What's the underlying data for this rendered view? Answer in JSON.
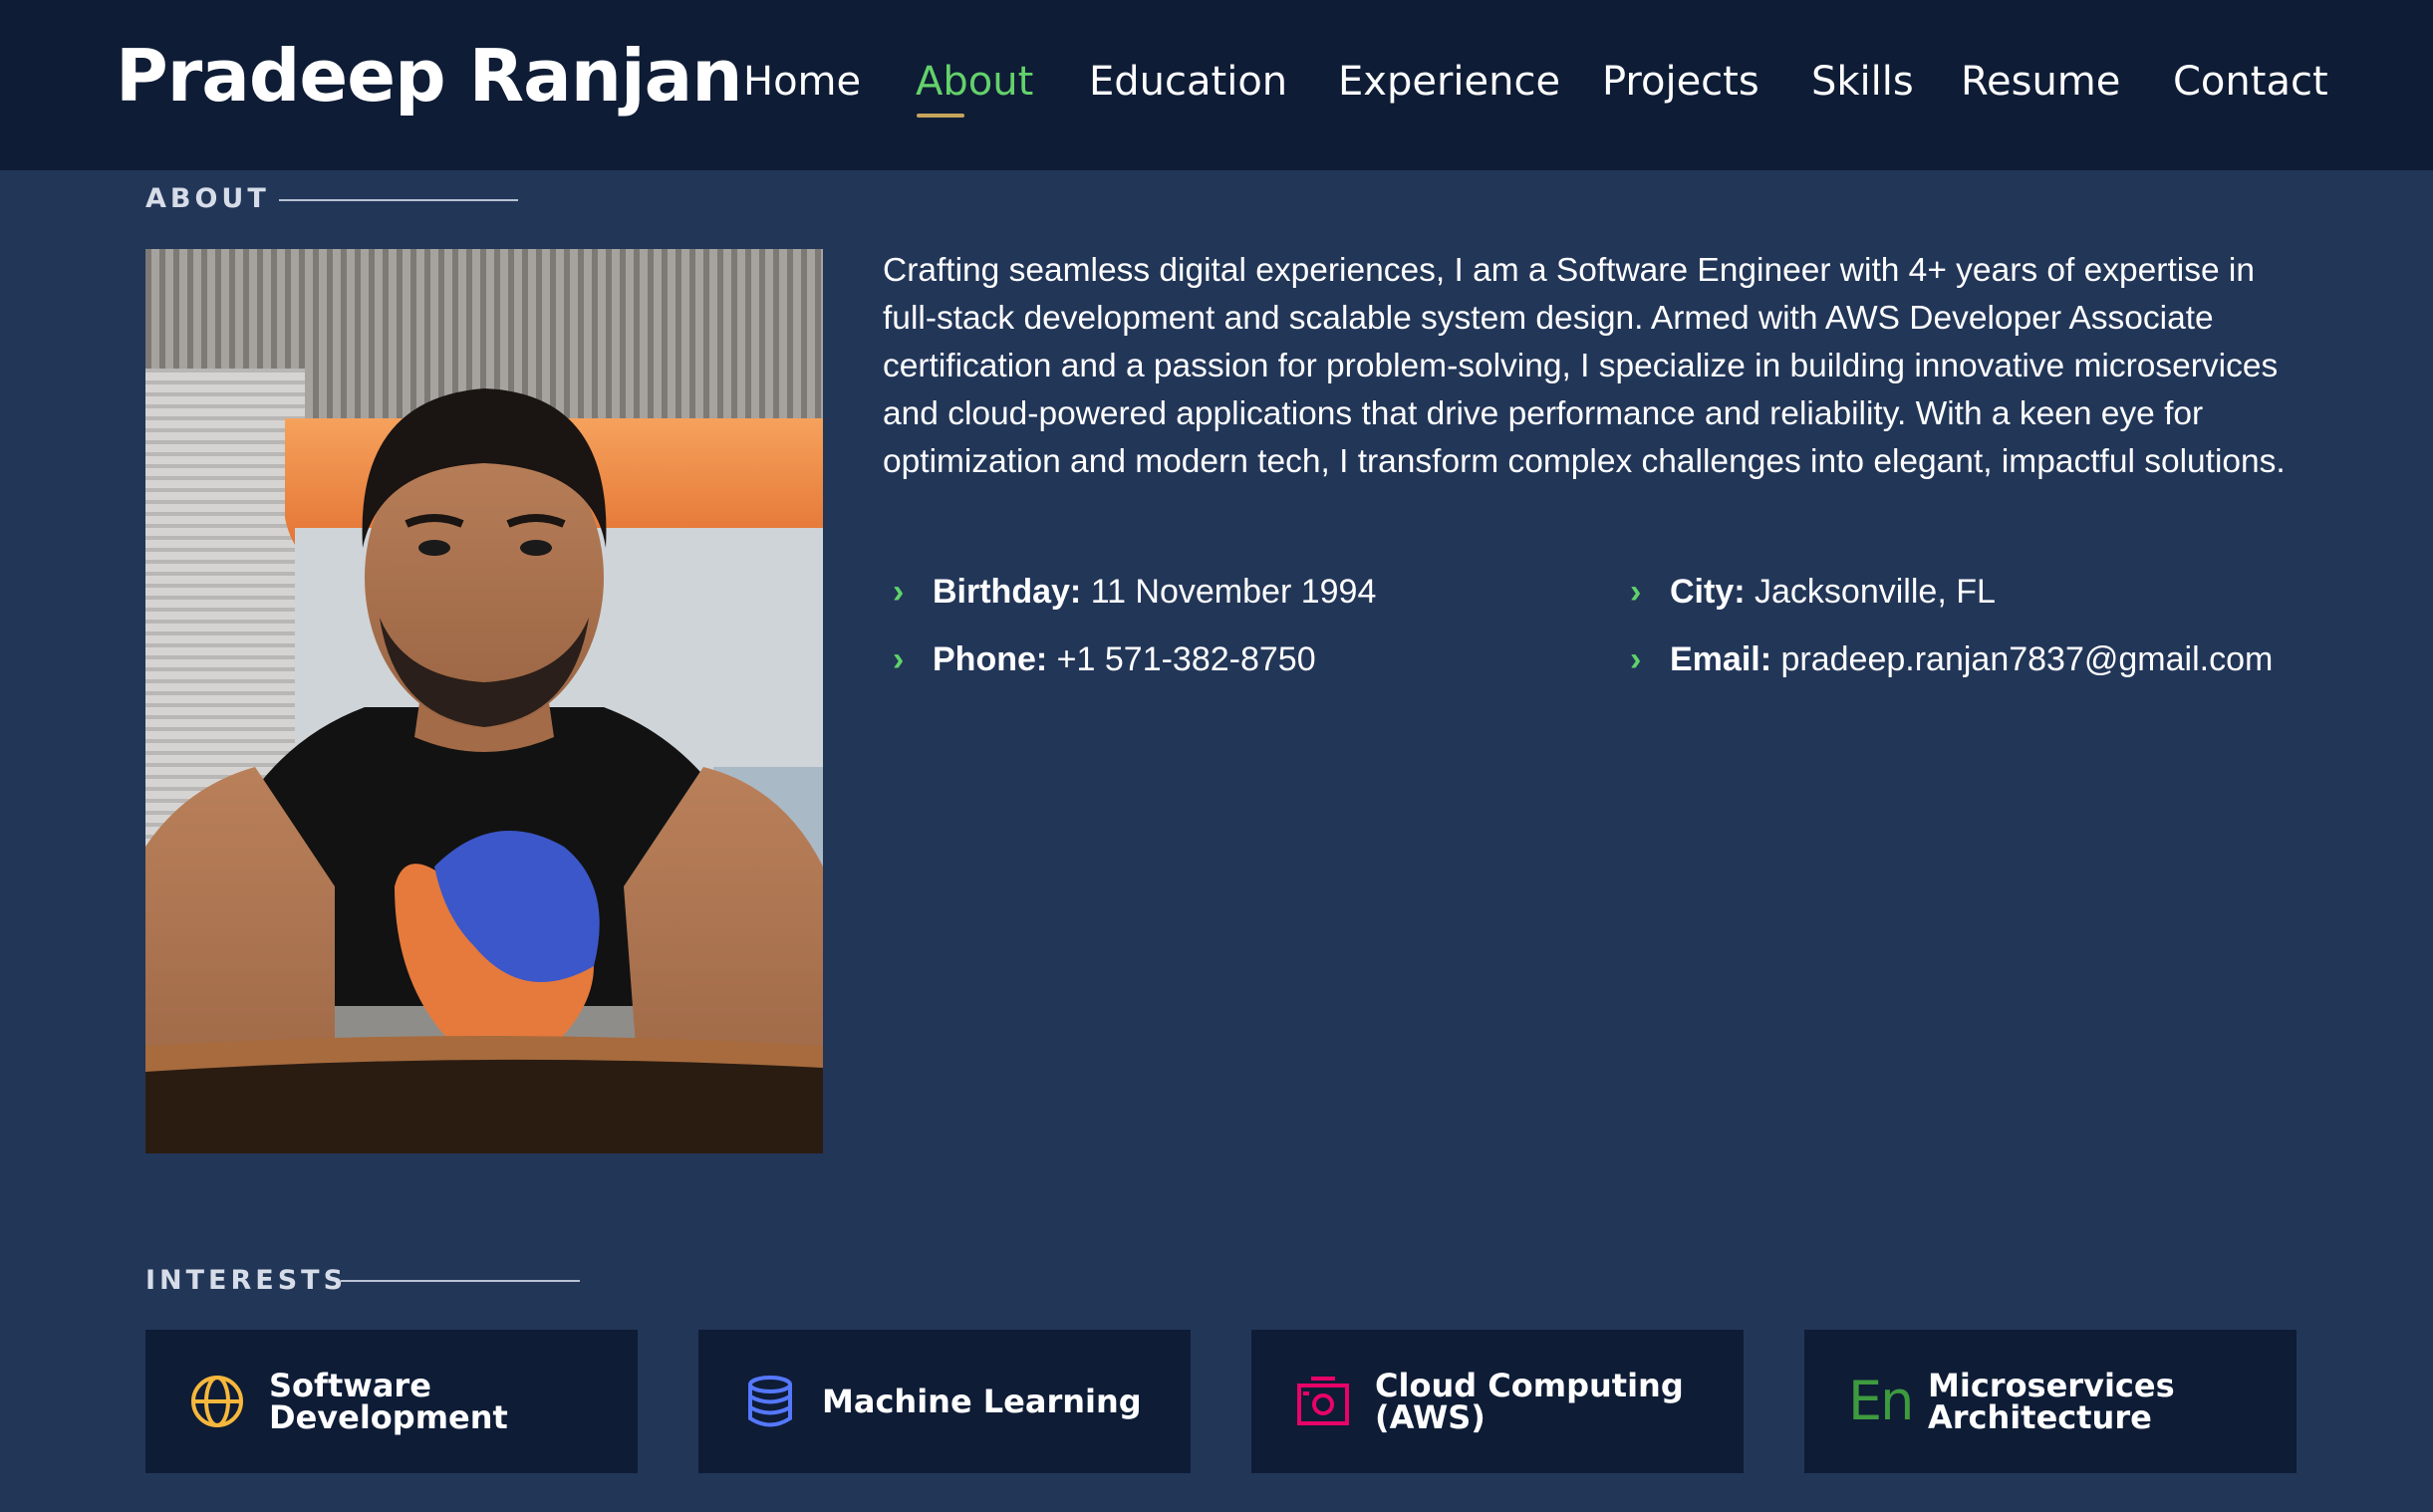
{
  "header": {
    "brand": "Pradeep Ranjan",
    "nav": [
      {
        "label": "Home",
        "active": false
      },
      {
        "label": "About",
        "active": true
      },
      {
        "label": "Education",
        "active": false
      },
      {
        "label": "Experience",
        "active": false
      },
      {
        "label": "Projects",
        "active": false
      },
      {
        "label": "Skills",
        "active": false
      },
      {
        "label": "Resume",
        "active": false
      },
      {
        "label": "Contact",
        "active": false
      }
    ]
  },
  "about": {
    "section_title": "ABOUT",
    "bio": "Crafting seamless digital experiences, I am a Software Engineer with 4+ years of expertise in full-stack development and scalable system design. Armed with AWS Developer Associate certification and a passion for problem-solving, I specialize in building innovative microservices and cloud-powered applications that drive performance and reliability. With a keen eye for optimization and modern tech, I transform complex challenges into elegant, impactful solutions.",
    "details": {
      "birthday": {
        "label": "Birthday:",
        "value": "11 November 1994"
      },
      "city": {
        "label": "City:",
        "value": "Jacksonville, FL"
      },
      "phone": {
        "label": "Phone:",
        "value": "+1 571-382-8750"
      },
      "email": {
        "label": "Email:",
        "value": "pradeep.ranjan7837@gmail.com"
      }
    },
    "bullet_icon": "chevron-right-icon"
  },
  "interests": {
    "section_title": "INTERESTS",
    "items": [
      {
        "label": "Software Development",
        "icon": "globe-icon",
        "color": "#f6b73c"
      },
      {
        "label": "Machine Learning",
        "icon": "database-icon",
        "color": "#5578ff"
      },
      {
        "label": "Cloud Computing (AWS)",
        "icon": "camera-icon",
        "color": "#e80368"
      },
      {
        "label": "Microservices Architecture",
        "icon": "english-icon",
        "icon_text": "En",
        "color": "#3e9a3e"
      }
    ]
  },
  "colors": {
    "page_bg": "#223658",
    "header_bg": "#0e1c36",
    "accent_green": "#64d26a",
    "underline_gold": "#c7a45b"
  }
}
